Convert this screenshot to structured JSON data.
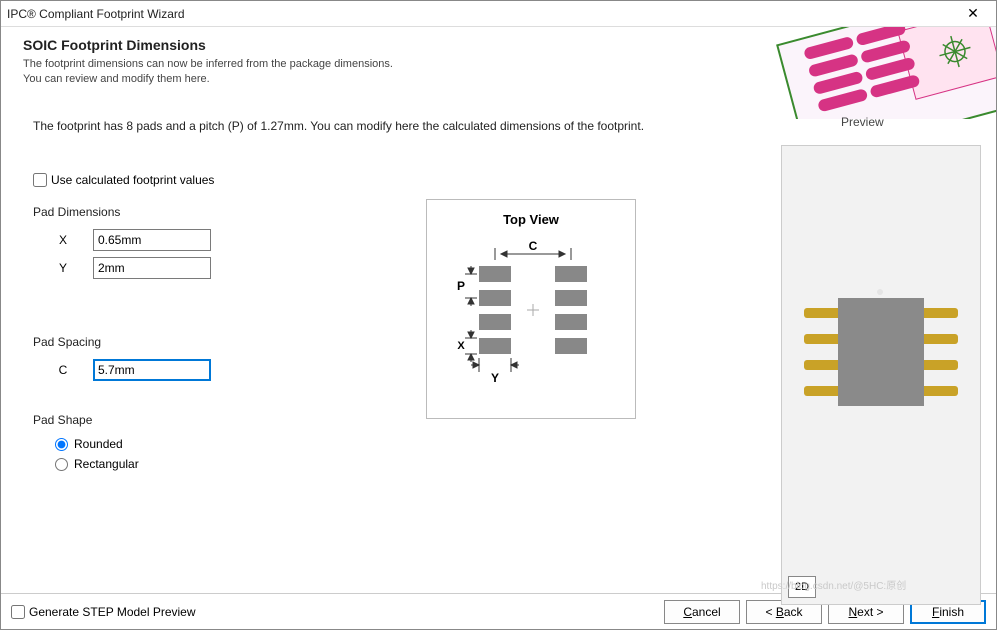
{
  "window": {
    "title": "IPC® Compliant Footprint Wizard"
  },
  "header": {
    "title": "SOIC Footprint Dimensions",
    "line1": "The footprint dimensions can now be inferred from the package dimensions.",
    "line2": "You can review and modify them here."
  },
  "info": "The footprint has 8 pads and a pitch (P) of 1.27mm. You can modify here the calculated dimensions of the footprint.",
  "previewLabel": "Preview",
  "form": {
    "useCalculated": "Use calculated footprint values",
    "padDimsTitle": "Pad Dimensions",
    "xLabel": "X",
    "xValue": "0.65mm",
    "yLabel": "Y",
    "yValue": "2mm",
    "padSpacingTitle": "Pad Spacing",
    "cLabel": "C",
    "cValue": "5.7mm",
    "padShapeTitle": "Pad Shape",
    "rounded": "Rounded",
    "rectangular": "Rectangular"
  },
  "diagram": {
    "title": "Top View",
    "P": "P",
    "X": "X",
    "Y": "Y",
    "C": "C"
  },
  "preview2d": "2D",
  "footer": {
    "generateStep": "Generate STEP Model Preview",
    "cancel": "Cancel",
    "back": "< Back",
    "next": "Next >",
    "finish": "Finish"
  },
  "watermark": "https://blog.csdn.net/@5HC:原创"
}
